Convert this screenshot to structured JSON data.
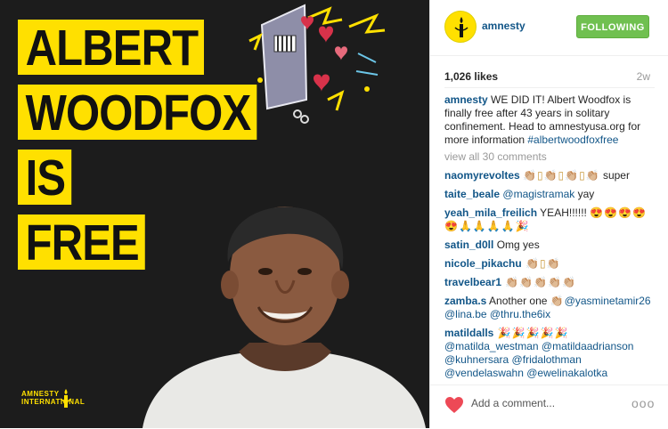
{
  "post_image": {
    "headline_lines": [
      "ALBERT",
      "WOODFOX",
      "IS",
      "FREE"
    ],
    "logo_text_line1": "AMNESTY",
    "logo_text_line2": "INTERNATIONAL",
    "brand_yellow": "#ffe000",
    "background": "#1c1c1c"
  },
  "header": {
    "username": "amnesty",
    "follow_label": "FOLLOWING",
    "follow_color": "#70c050"
  },
  "stats": {
    "likes": "1,026 likes",
    "age": "2w"
  },
  "caption": {
    "user": "amnesty",
    "text": " WE DID IT! Albert Woodfox is finally free after 43 years in solitary confinement. Head to amnestyusa.org for more information ",
    "hashtag": "#albertwoodfoxfree"
  },
  "view_all": "view all 30 comments",
  "comments": [
    {
      "user": "naomyrevoltes",
      "emoji": "👏🏼▯👏🏼▯👏🏼▯👏🏼",
      "text": " super"
    },
    {
      "user": "taite_beale",
      "mention": "@magistramak",
      "text": " yay"
    },
    {
      "user": "yeah_mila_freilich",
      "text": " YEAH!!!!!! ",
      "emoji": "😍😍😍😍😍🙏🙏🙏🙏🎉"
    },
    {
      "user": "satin_d0ll",
      "text": " Omg yes"
    },
    {
      "user": "nicole_pikachu",
      "emoji": " 👏🏼▯👏🏼"
    },
    {
      "user": "travelbear1",
      "emoji": " 👏🏼👏🏼👏🏼👏🏼👏🏼"
    },
    {
      "user": "zamba.s",
      "text": " Another one ",
      "emoji": "👏🏼",
      "mentions": "@yasminetamir26 @lina.be @thru.the6ix"
    },
    {
      "user": "matildalls",
      "emoji": " 🎉🎉🎉🎉🎉",
      "mentions": "@matilda_westman @matildaadrianson @kuhnersara @fridalothman @vendelaswahn @ewelinakalotka"
    }
  ],
  "footer": {
    "placeholder": "Add a comment...",
    "more": "ooo",
    "heart_color": "#ed4956"
  }
}
